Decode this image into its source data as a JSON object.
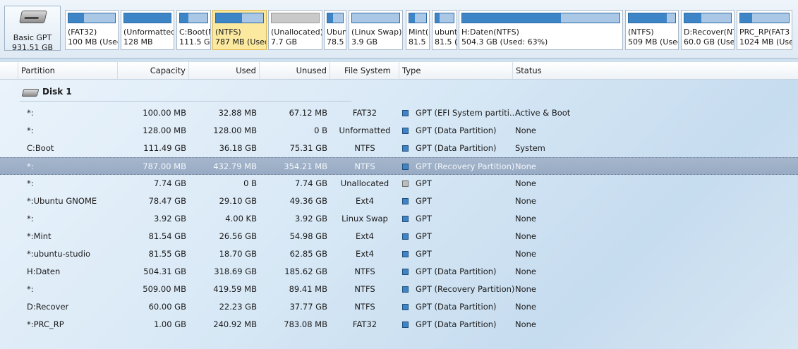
{
  "disk_map": {
    "disk_label": "Basic GPT",
    "disk_size": "931.51 GB",
    "partitions": [
      {
        "l1": "(FAT32)",
        "l2": "100 MB (Used:",
        "used": 0.33,
        "unalloc": false
      },
      {
        "l1": "(Unformatted)",
        "l2": "128 MB",
        "used": 1.0,
        "unalloc": false
      },
      {
        "l1": "C:Boot(N",
        "l2": "111.5 GB",
        "used": 0.32,
        "unalloc": false
      },
      {
        "l1": "(NTFS)",
        "l2": "787 MB (Used:",
        "used": 0.55,
        "unalloc": false,
        "selected": true
      },
      {
        "l1": "(Unallocated)",
        "l2": "7.7 GB",
        "used": 0,
        "unalloc": true
      },
      {
        "l1": "Ubun",
        "l2": "78.5",
        "used": 0.37,
        "unalloc": false
      },
      {
        "l1": "(Linux Swap)",
        "l2": "3.9 GB",
        "used": 0,
        "unalloc": false
      },
      {
        "l1": "Mint(E",
        "l2": "81.5 (",
        "used": 0.33,
        "unalloc": false
      },
      {
        "l1": "ubunt",
        "l2": "81.5 (",
        "used": 0.23,
        "unalloc": false
      },
      {
        "l1": "H:Daten(NTFS)",
        "l2": "504.3 GB (Used: 63%)",
        "used": 0.63,
        "unalloc": false
      },
      {
        "l1": "(NTFS)",
        "l2": "509 MB (Used:",
        "used": 0.82,
        "unalloc": false
      },
      {
        "l1": "D:Recover(NT",
        "l2": "60.0 GB (Used",
        "used": 0.37,
        "unalloc": false
      },
      {
        "l1": "PRC_RP(FAT3",
        "l2": "1024 MB (Usec",
        "used": 0.24,
        "unalloc": false
      }
    ]
  },
  "columns": {
    "partition": "Partition",
    "capacity": "Capacity",
    "used": "Used",
    "unused": "Unused",
    "fs": "File System",
    "type": "Type",
    "status": "Status"
  },
  "disk": {
    "label": "Disk 1"
  },
  "rows": [
    {
      "partition": "*:",
      "capacity": "100.00 MB",
      "used": "32.88 MB",
      "unused": "67.12 MB",
      "fs": "FAT32",
      "type": "GPT (EFI System partiti...",
      "status": "Active & Boot",
      "gray": false
    },
    {
      "partition": "*:",
      "capacity": "128.00 MB",
      "used": "128.00 MB",
      "unused": "0 B",
      "fs": "Unformatted",
      "type": "GPT (Data Partition)",
      "status": "None",
      "gray": false
    },
    {
      "partition": "C:Boot",
      "capacity": "111.49 GB",
      "used": "36.18 GB",
      "unused": "75.31 GB",
      "fs": "NTFS",
      "type": "GPT (Data Partition)",
      "status": "System",
      "gray": false
    },
    {
      "partition": "*:",
      "capacity": "787.00 MB",
      "used": "432.79 MB",
      "unused": "354.21 MB",
      "fs": "NTFS",
      "type": "GPT (Recovery Partition)",
      "status": "None",
      "gray": false,
      "selected": true
    },
    {
      "partition": "*:",
      "capacity": "7.74 GB",
      "used": "0 B",
      "unused": "7.74 GB",
      "fs": "Unallocated",
      "type": "GPT",
      "status": "None",
      "gray": true
    },
    {
      "partition": "*:Ubuntu GNOME",
      "capacity": "78.47 GB",
      "used": "29.10 GB",
      "unused": "49.36 GB",
      "fs": "Ext4",
      "type": "GPT",
      "status": "None",
      "gray": false
    },
    {
      "partition": "*:",
      "capacity": "3.92 GB",
      "used": "4.00 KB",
      "unused": "3.92 GB",
      "fs": "Linux Swap",
      "type": "GPT",
      "status": "None",
      "gray": false
    },
    {
      "partition": "*:Mint",
      "capacity": "81.54 GB",
      "used": "26.56 GB",
      "unused": "54.98 GB",
      "fs": "Ext4",
      "type": "GPT",
      "status": "None",
      "gray": false
    },
    {
      "partition": "*:ubuntu-studio",
      "capacity": "81.55 GB",
      "used": "18.70 GB",
      "unused": "62.85 GB",
      "fs": "Ext4",
      "type": "GPT",
      "status": "None",
      "gray": false
    },
    {
      "partition": "H:Daten",
      "capacity": "504.31 GB",
      "used": "318.69 GB",
      "unused": "185.62 GB",
      "fs": "NTFS",
      "type": "GPT (Data Partition)",
      "status": "None",
      "gray": false
    },
    {
      "partition": "*:",
      "capacity": "509.00 MB",
      "used": "419.59 MB",
      "unused": "89.41 MB",
      "fs": "NTFS",
      "type": "GPT (Recovery Partition)",
      "status": "None",
      "gray": false
    },
    {
      "partition": "D:Recover",
      "capacity": "60.00 GB",
      "used": "22.23 GB",
      "unused": "37.77 GB",
      "fs": "NTFS",
      "type": "GPT (Data Partition)",
      "status": "None",
      "gray": false
    },
    {
      "partition": "*:PRC_RP",
      "capacity": "1.00 GB",
      "used": "240.92 MB",
      "unused": "783.08 MB",
      "fs": "FAT32",
      "type": "GPT (Data Partition)",
      "status": "None",
      "gray": false
    }
  ]
}
